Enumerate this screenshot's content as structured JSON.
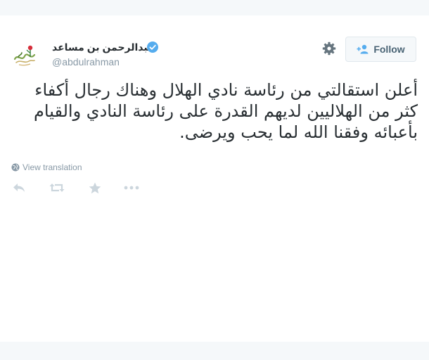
{
  "user": {
    "display_name": "عبدالرحمن بن مساعد",
    "screen_name": "@abdulrahman",
    "verified": true
  },
  "header": {
    "follow_label": "Follow"
  },
  "tweet": {
    "text": "أعلن استقالتي من رئاسة نادي الهلال وهناك رجال أكفاء كثر من الهلاليين لديهم القدرة على رئاسة النادي والقيام بأعبائه وفقنا الله لما يحب ويرضى."
  },
  "translation": {
    "label": "View translation"
  },
  "actions": {
    "icons": [
      "reply-icon",
      "retweet-icon",
      "favorite-icon",
      "more-icon"
    ]
  },
  "colors": {
    "text": "#292f33",
    "muted": "#8899a6",
    "verified": "#55acee",
    "follow_text": "#4a6475",
    "strip_bg": "#f5f8fa"
  }
}
